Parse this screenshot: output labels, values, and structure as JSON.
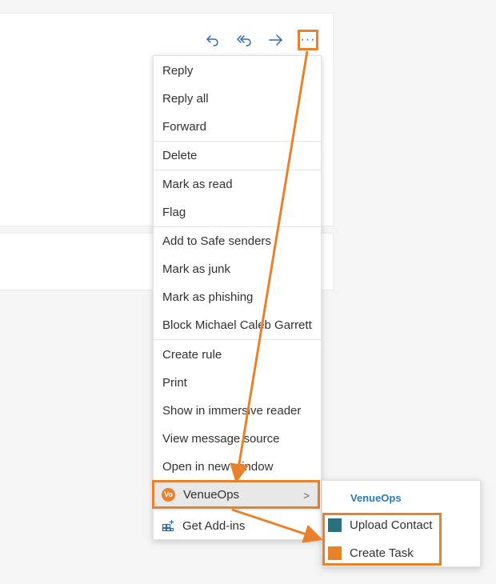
{
  "toolbar": {
    "reply_icon": "reply-icon",
    "reply_all_icon": "reply-all-icon",
    "forward_icon": "forward-icon",
    "more_label": "···"
  },
  "menu": {
    "items": [
      {
        "label": "Reply"
      },
      {
        "label": "Reply all"
      },
      {
        "label": "Forward"
      },
      {
        "label": "Delete"
      },
      {
        "label": "Mark as read"
      },
      {
        "label": "Flag"
      },
      {
        "label": "Add to Safe senders"
      },
      {
        "label": "Mark as junk"
      },
      {
        "label": "Mark as phishing"
      },
      {
        "label": "Block Michael Caleb Garrett"
      },
      {
        "label": "Create rule"
      },
      {
        "label": "Print"
      },
      {
        "label": "Show in immersive reader"
      },
      {
        "label": "View message source"
      },
      {
        "label": "Open in new window"
      }
    ],
    "venueops_label": "VenueOps",
    "venueops_logo_text": "Vo",
    "get_addins_label": "Get Add-ins"
  },
  "submenu": {
    "title": "VenueOps",
    "items": [
      {
        "label": "Upload Contact",
        "color": "#2e6f7e"
      },
      {
        "label": "Create Task",
        "color": "#e8812a"
      }
    ]
  },
  "colors": {
    "accent": "#2b6cb0",
    "highlight": "#e8812a"
  }
}
